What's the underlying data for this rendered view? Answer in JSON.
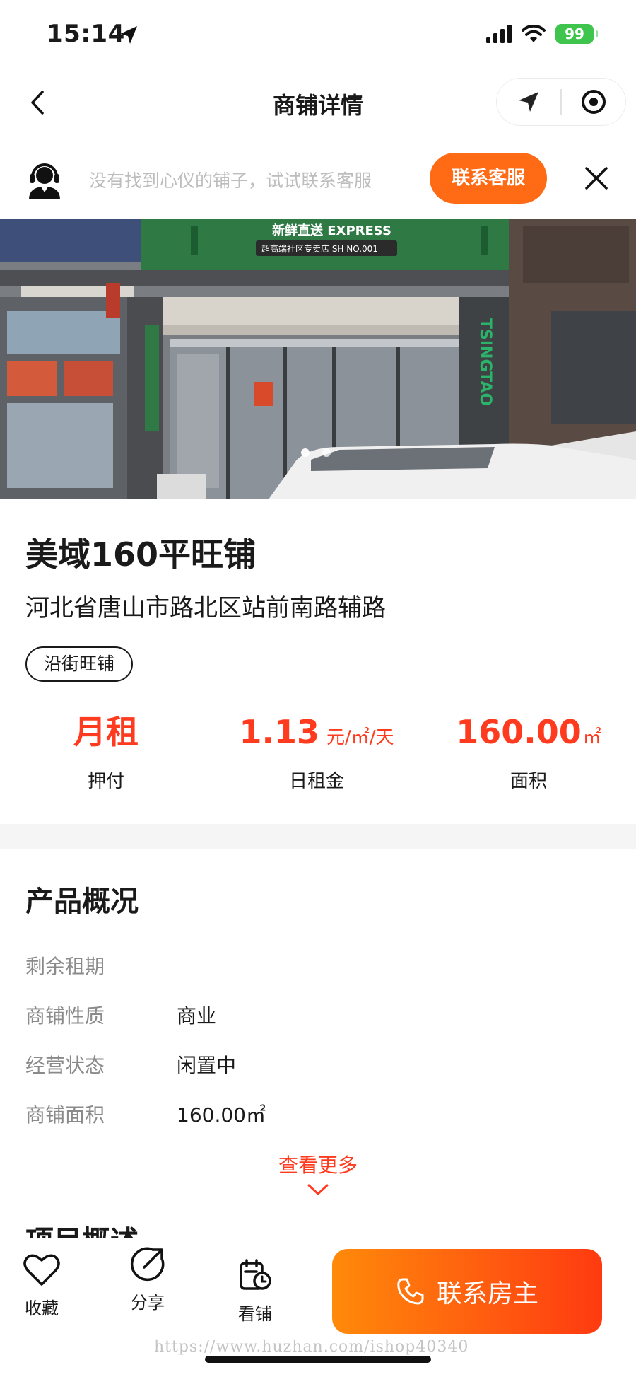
{
  "status_bar": {
    "time": "15:14",
    "battery": "99"
  },
  "nav": {
    "title": "商铺详情"
  },
  "service_banner": {
    "text": "没有找到心仪的铺子，试试联系客服",
    "button": "联系客服"
  },
  "listing": {
    "title": "美域160平旺铺",
    "address": "河北省唐山市路北区站前南路辅路",
    "tag": "沿街旺铺",
    "stats": [
      {
        "value": "月租",
        "unit": "",
        "label": "押付"
      },
      {
        "value": "1.13",
        "unit": "元/㎡/天",
        "label": "日租金"
      },
      {
        "value": "160.00",
        "unit": "㎡",
        "label": "面积"
      }
    ]
  },
  "overview": {
    "title": "产品概况",
    "rows": [
      {
        "key": "剩余租期",
        "value": ""
      },
      {
        "key": "商铺性质",
        "value": "商业"
      },
      {
        "key": "经营状态",
        "value": "闲置中"
      },
      {
        "key": "商铺面积",
        "value": "160.00㎡"
      }
    ],
    "more": "查看更多",
    "next_section": "项目概述"
  },
  "photo": {
    "sign_text": "新鲜直送 EXPRESS",
    "sign_sub": "超高端社区专卖店 SH NO.001",
    "brand_text": "TSINGTAO"
  },
  "bottom_bar": {
    "favorite": "收藏",
    "share": "分享",
    "view": "看铺",
    "call": "联系房主"
  },
  "watermark": "https://www.huzhan.com/ishop40340",
  "colors": {
    "accent": "#ff3b1f",
    "button": "#ff6a14"
  },
  "icons": [
    "location-arrow-icon",
    "signal-icon",
    "wifi-icon",
    "battery-icon",
    "back-icon",
    "navigate-icon",
    "target-icon",
    "customer-service-icon",
    "close-icon",
    "chevron-down-icon",
    "heart-icon",
    "share-icon",
    "calendar-clock-icon",
    "phone-icon"
  ]
}
